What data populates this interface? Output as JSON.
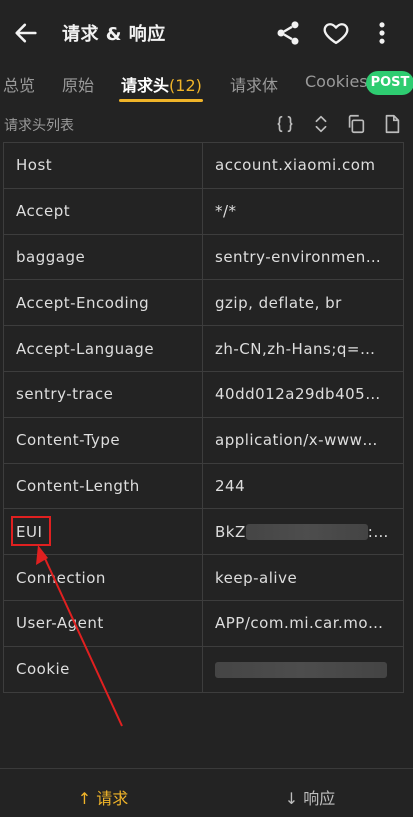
{
  "app_bar": {
    "title": "请求 & 响应"
  },
  "tabs": [
    {
      "label": "总览",
      "active": false
    },
    {
      "label": "原始",
      "active": false
    },
    {
      "label": "请求头",
      "count": "(12)",
      "active": true
    },
    {
      "label": "请求体",
      "active": false
    },
    {
      "label": "Cookies",
      "active": false
    }
  ],
  "method_badge": "POST",
  "section": {
    "title": "请求头列表"
  },
  "headers": [
    {
      "key": "Host",
      "value": "account.xiaomi.com"
    },
    {
      "key": "Accept",
      "value": "*/*"
    },
    {
      "key": "baggage",
      "value": "sentry-environmen…"
    },
    {
      "key": "Accept-Encoding",
      "value": "gzip, deflate, br"
    },
    {
      "key": "Accept-Language",
      "value": "zh-CN,zh-Hans;q=…"
    },
    {
      "key": "sentry-trace",
      "value": "40dd012a29db405…"
    },
    {
      "key": "Content-Type",
      "value": "application/x-www…"
    },
    {
      "key": "Content-Length",
      "value": "244"
    },
    {
      "key": "EUI",
      "value_prefix": "BkZ",
      "value_suffix": ":…",
      "redacted": true
    },
    {
      "key": "Connection",
      "value": "keep-alive"
    },
    {
      "key": "User-Agent",
      "value": "APP/com.mi.car.mo…"
    },
    {
      "key": "Cookie",
      "redacted": true
    }
  ],
  "bottom_bar": {
    "request_label": "↑ 请求",
    "response_label": "↓ 响应"
  },
  "colors": {
    "accent": "#f0b429",
    "badge": "#2ecc71",
    "highlight": "#e02020",
    "background": "#232323"
  }
}
